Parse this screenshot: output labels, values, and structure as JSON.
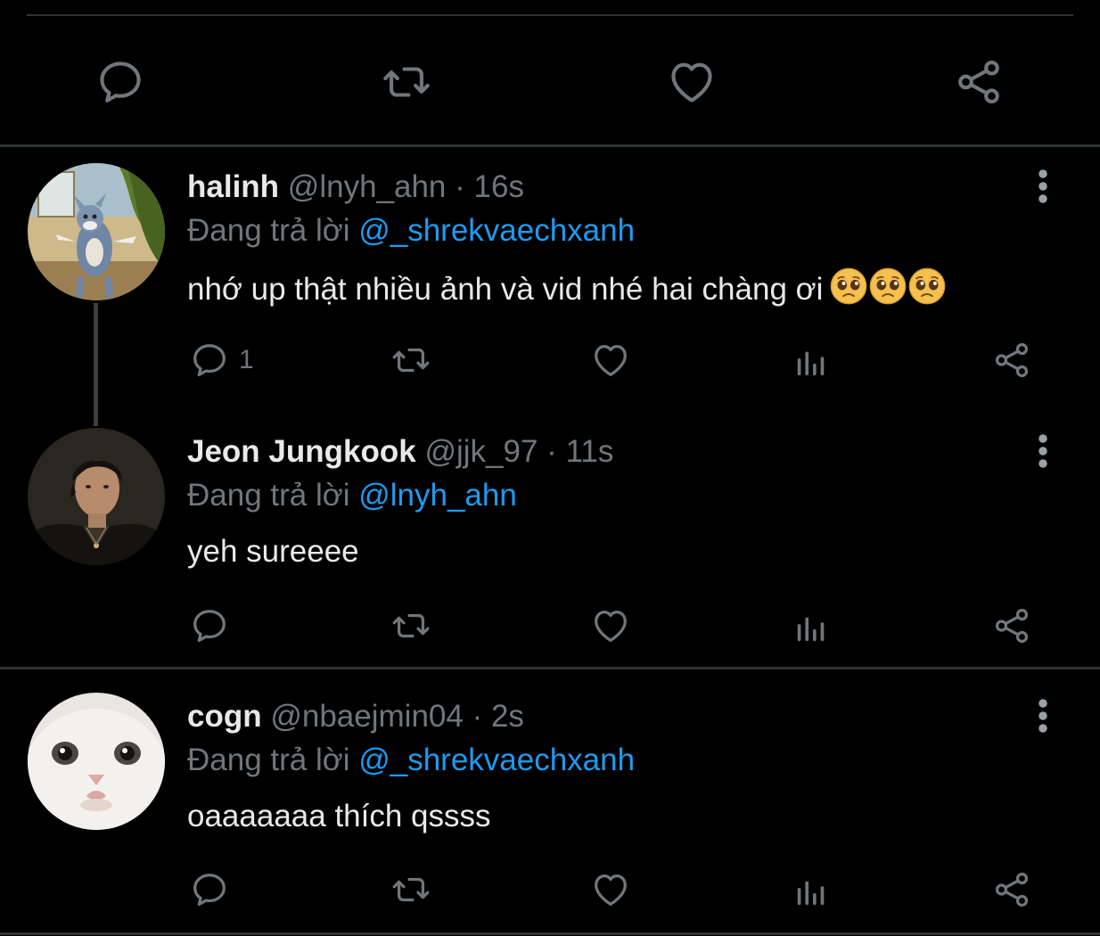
{
  "colors": {
    "background": "#000000",
    "divider": "#2f3336",
    "text": "#e7e9ea",
    "muted": "#71767b",
    "accent": "#1d9bf0"
  },
  "main_actions": {
    "icons": [
      "reply-icon",
      "retweet-icon",
      "like-icon",
      "share-icon"
    ]
  },
  "tweets": [
    {
      "name": "halinh",
      "handle": "@lnyh_ahn",
      "time": "16s",
      "reply_prefix": "Đang trả lời",
      "reply_to": "@_shrekvaechxanh",
      "text": "nhớ up thật nhiều ảnh và vid nhé hai chàng ơi",
      "emoji": [
        "pleading-face",
        "pleading-face",
        "pleading-face"
      ],
      "reply_count": "1",
      "avatar": "tom-cat-avatar"
    },
    {
      "name": "Jeon Jungkook",
      "handle": "@jjk_97",
      "time": "11s",
      "reply_prefix": "Đang trả lời",
      "reply_to": "@lnyh_ahn",
      "text": "yeh sureeee",
      "reply_count": "",
      "avatar": "man-portrait-avatar"
    },
    {
      "name": "cogn",
      "handle": "@nbaejmin04",
      "time": "2s",
      "reply_prefix": "Đang trả lời",
      "reply_to": "@_shrekvaechxanh",
      "text": "oaaaaaaa thích qssss",
      "reply_count": "",
      "avatar": "white-cat-avatar"
    }
  ]
}
